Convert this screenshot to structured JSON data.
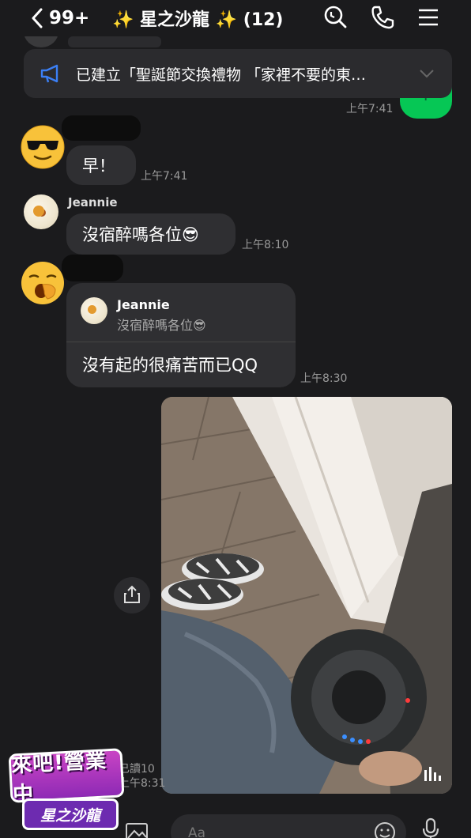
{
  "header": {
    "back_count": "99+",
    "title": "✨ 星之沙龍 ✨ (12)",
    "icons": [
      "search-icon",
      "phone-icon",
      "menu-icon"
    ]
  },
  "announcement": {
    "text": "已建立「聖誕節交換禮物 「家裡不要的東…",
    "icon": "megaphone-icon"
  },
  "messages": [
    {
      "id": "m1",
      "time": "上午7:41",
      "side": "right"
    },
    {
      "id": "m2",
      "text": "早！",
      "time": "上午7:41",
      "avatar_icon": "sunglasses-emoji"
    },
    {
      "id": "m3",
      "sender": "Jeannie",
      "text": "沒宿醉嗎各位😎",
      "time": "上午8:10"
    },
    {
      "id": "m4",
      "reply_to_sender": "Jeannie",
      "reply_to_text": "沒宿醉嗎各位😎",
      "text": "沒有起的很痛苦而已QQ",
      "time": "上午8:30",
      "avatar_icon": "yawning-emoji"
    }
  ],
  "video_message": {
    "read_label": "已讀10",
    "time": "上午8:31"
  },
  "composer": {
    "placeholder": "Aa"
  },
  "logo": {
    "line1": "來吧!營業中",
    "line2": "星之沙龍"
  },
  "colors": {
    "background": "#1b1b1d",
    "bubble": "#2f2f32",
    "accent_green": "#06c755",
    "announce_icon": "#3b7ff5"
  }
}
